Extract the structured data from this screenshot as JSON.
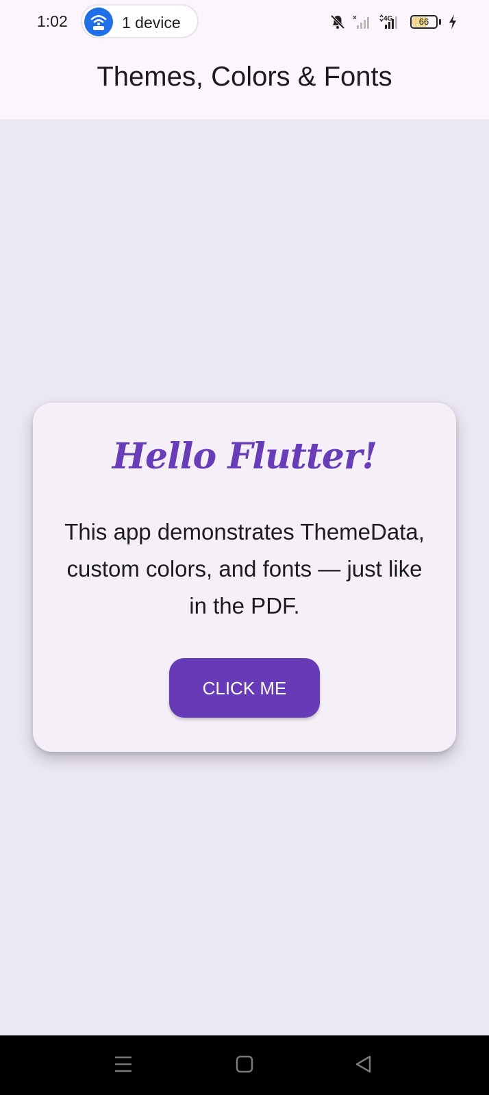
{
  "status_bar": {
    "time": "1:02",
    "hotspot_label": "1 device",
    "network_label": "4G",
    "battery_level": "66",
    "battery_percent": 66,
    "icons": [
      "wifi-hotspot-icon",
      "mute-icon",
      "signal-x-icon",
      "signal-4g-icon",
      "battery-icon",
      "charging-icon"
    ]
  },
  "app_bar": {
    "title": "Themes, Colors & Fonts"
  },
  "card": {
    "heading": "Hello Flutter!",
    "body": "This app demonstrates ThemeData, custom colors, and fonts — just like in the PDF.",
    "button_label": "CLICK ME"
  },
  "nav_bar": {
    "icons": [
      "menu-icon",
      "home-icon",
      "back-icon"
    ]
  },
  "colors": {
    "primary": "#673AB7",
    "heading": "#6A3DB8",
    "background": "#ECE7F5",
    "card": "#F5F0F8",
    "app_bar": "#FCF6FC",
    "hotspot": "#1E6FE8"
  }
}
